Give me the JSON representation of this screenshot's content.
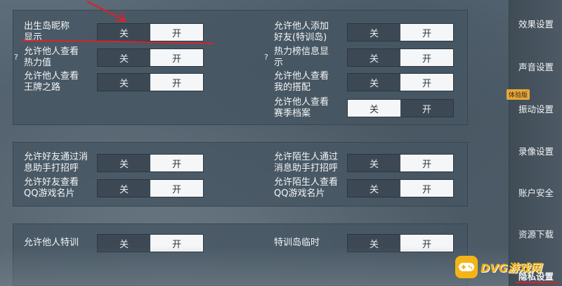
{
  "sections": [
    {
      "rows": [
        {
          "id": "birth-island-nickname",
          "label": "出生岛昵称\n显示",
          "off": "关",
          "on": "开",
          "selected": "on",
          "help": false
        },
        {
          "id": "heat-value",
          "label": "允许他人查看\n热力值",
          "off": "关",
          "on": "开",
          "selected": "on",
          "help": true
        },
        {
          "id": "ace-road",
          "label": "允许他人查看\n王牌之路",
          "off": "关",
          "on": "开",
          "selected": "on",
          "help": false
        },
        {
          "id": "add-friend-training",
          "label": "允许他人添加\n好友(特训岛)",
          "off": "关",
          "on": "开",
          "selected": "on",
          "help": false
        },
        {
          "id": "heat-rank-info",
          "label": "热力榜信息显\n示",
          "off": "关",
          "on": "开",
          "selected": "on",
          "help": true
        },
        {
          "id": "my-outfit",
          "label": "允许他人查看\n我的搭配",
          "off": "关",
          "on": "开",
          "selected": "on",
          "help": false
        },
        {
          "id": "season-archive",
          "label": "允许他人查看\n赛季档案",
          "off": "关",
          "on": "开",
          "selected": "off",
          "help": false
        }
      ]
    },
    {
      "rows": [
        {
          "id": "friend-assistant-greet",
          "label": "允许好友通过消\n息助手打招呼",
          "off": "关",
          "on": "开",
          "selected": "on"
        },
        {
          "id": "friend-qq-card",
          "label": "允许好友查看\nQQ游戏名片",
          "off": "关",
          "on": "开",
          "selected": "on"
        },
        {
          "id": "stranger-assistant-greet",
          "label": "允许陌生人通过\n消息助手打招呼",
          "off": "关",
          "on": "开",
          "selected": "on"
        },
        {
          "id": "stranger-qq-card",
          "label": "允许陌生人查看\nQQ游戏名片",
          "off": "关",
          "on": "开",
          "selected": "on"
        }
      ]
    },
    {
      "rows": [
        {
          "id": "others-training",
          "label": "允许他人特训",
          "off": "关",
          "on": "开",
          "selected": "on"
        },
        {
          "id": "training-island-temp",
          "label": "特训岛临时",
          "off": "关",
          "on": "开",
          "selected": "on"
        }
      ]
    }
  ],
  "help_mark": "?",
  "sidebar": {
    "items": [
      {
        "label": "效果设置"
      },
      {
        "label": "声音设置"
      },
      {
        "label": "振动设置",
        "badge": "体验版"
      },
      {
        "label": "录像设置"
      },
      {
        "label": "账户安全"
      },
      {
        "label": "资源下载"
      },
      {
        "label": "隐私设置",
        "active": true
      }
    ]
  },
  "watermark": {
    "text": "DVG游戏网"
  },
  "colors": {
    "annotation": "#d8232a",
    "watermark": "#f3b417",
    "badge": "#e6a73a"
  }
}
